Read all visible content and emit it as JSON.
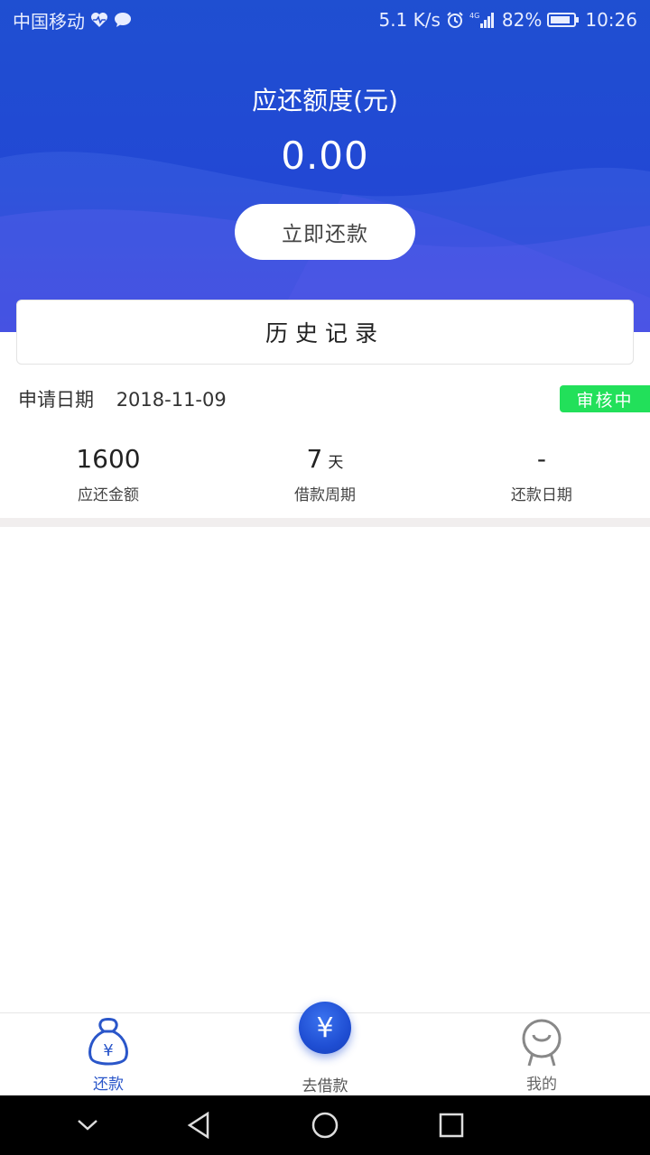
{
  "status_bar": {
    "carrier": "中国移动",
    "speed": "5.1 K/s",
    "network": "4G",
    "battery": "82%",
    "time": "10:26",
    "icons": [
      "heart-rate-icon",
      "chat-bubble-icon",
      "alarm-icon",
      "signal-icon",
      "battery-icon"
    ]
  },
  "header": {
    "title": "应还额度(元)",
    "amount": "0.00",
    "repay_button": "立即还款"
  },
  "history": {
    "title": "历史记录"
  },
  "record": {
    "date_label": "申请日期",
    "date_value": "2018-11-09",
    "status": "审核中",
    "stats": [
      {
        "value": "1600",
        "unit": "",
        "label": "应还金额"
      },
      {
        "value": "7",
        "unit": "天",
        "label": "借款周期"
      },
      {
        "value": "-",
        "unit": "",
        "label": "还款日期"
      }
    ]
  },
  "tabbar": {
    "tabs": [
      {
        "label": "还款",
        "icon": "money-bag-icon",
        "active": true
      },
      {
        "label": "去借款",
        "icon": "yen-coin-icon",
        "active": false
      },
      {
        "label": "我的",
        "icon": "profile-icon",
        "active": false
      }
    ],
    "center_symbol": "¥",
    "bag_symbol": "¥"
  },
  "colors": {
    "primary": "#1f4fd1",
    "status_badge": "#22e05a",
    "active_tab": "#2a56c9"
  }
}
